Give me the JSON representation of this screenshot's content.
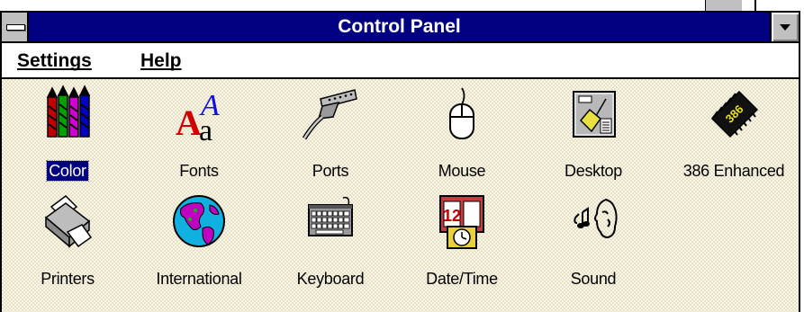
{
  "window": {
    "title": "Control Panel"
  },
  "menu": {
    "settings": "Settings",
    "help": "Help"
  },
  "icons": [
    {
      "label": "Color",
      "icon": "crayons-icon",
      "selected": true
    },
    {
      "label": "Fonts",
      "icon": "fonts-icon"
    },
    {
      "label": "Ports",
      "icon": "ports-icon"
    },
    {
      "label": "Mouse",
      "icon": "mouse-icon"
    },
    {
      "label": "Desktop",
      "icon": "desktop-icon"
    },
    {
      "label": "386 Enhanced",
      "icon": "chip-icon"
    },
    {
      "label": "Printers",
      "icon": "printer-icon"
    },
    {
      "label": "International",
      "icon": "globe-icon"
    },
    {
      "label": "Keyboard",
      "icon": "keyboard-icon"
    },
    {
      "label": "Date/Time",
      "icon": "calendar-clock-icon"
    },
    {
      "label": "Sound",
      "icon": "sound-icon"
    }
  ],
  "chip_text": "386",
  "calendar_text": "12",
  "colors": {
    "titlebar": "#000080",
    "selection": "#000080",
    "client_bg": "#fbf8ea"
  }
}
